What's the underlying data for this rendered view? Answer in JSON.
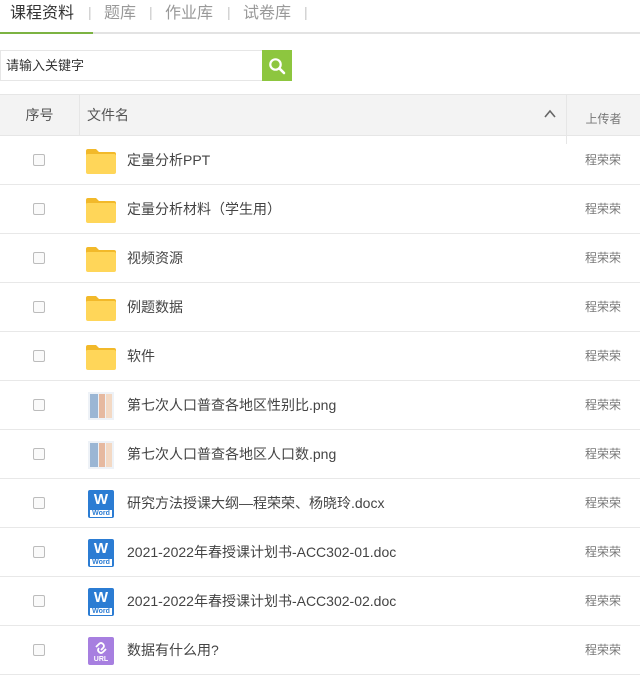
{
  "tabs": [
    {
      "label": "课程资料",
      "active": true
    },
    {
      "label": "题库",
      "active": false
    },
    {
      "label": "作业库",
      "active": false
    },
    {
      "label": "试卷库",
      "active": false
    }
  ],
  "separator": "|",
  "search": {
    "placeholder": "请输入关键字",
    "icon": "search-icon"
  },
  "colors": {
    "accent": "#8dc63f",
    "folder": "#ffd659",
    "word": "#2b7cd3",
    "link": "#a77fe0"
  },
  "table": {
    "headers": {
      "seq": "序号",
      "name": "文件名",
      "uploader": "上传者"
    },
    "sort_icon": "chevron-up-icon",
    "rows": [
      {
        "type": "folder",
        "name": "定量分析PPT",
        "uploader": "程荣荣"
      },
      {
        "type": "folder",
        "name": "定量分析材料（学生用）",
        "uploader": "程荣荣"
      },
      {
        "type": "folder",
        "name": "视频资源",
        "uploader": "程荣荣"
      },
      {
        "type": "folder",
        "name": "例题数据",
        "uploader": "程荣荣"
      },
      {
        "type": "folder",
        "name": "软件",
        "uploader": "程荣荣"
      },
      {
        "type": "image",
        "name": "第七次人口普查各地区性别比.png",
        "uploader": "程荣荣"
      },
      {
        "type": "image",
        "name": "第七次人口普查各地区人口数.png",
        "uploader": "程荣荣"
      },
      {
        "type": "word",
        "name": "研究方法授课大纲—程荣荣、杨晓玲.docx",
        "uploader": "程荣荣",
        "icon_text": "W",
        "icon_tag": "Word"
      },
      {
        "type": "word",
        "name": "2021-2022年春授课计划书-ACC302-01.doc",
        "uploader": "程荣荣",
        "icon_text": "W",
        "icon_tag": "Word"
      },
      {
        "type": "word",
        "name": "2021-2022年春授课计划书-ACC302-02.doc",
        "uploader": "程荣荣",
        "icon_text": "W",
        "icon_tag": "Word"
      },
      {
        "type": "link",
        "name": "数据有什么用?",
        "uploader": "程荣荣",
        "icon_tag": "URL"
      }
    ]
  }
}
